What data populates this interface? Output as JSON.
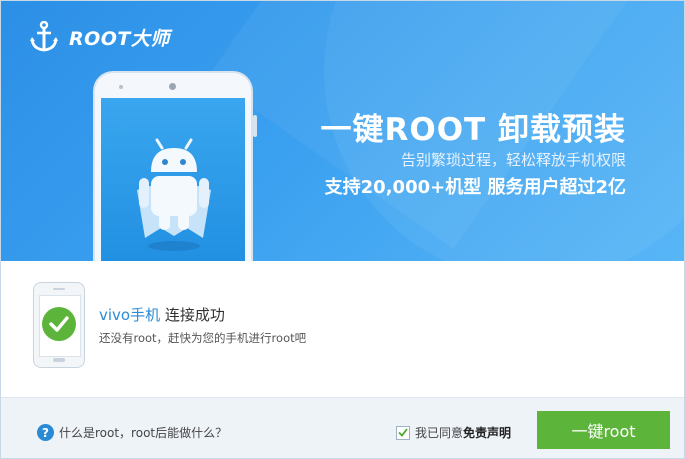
{
  "app": {
    "logo_text": "ROOT大师",
    "logo_icon": "anchor-icon"
  },
  "banner": {
    "headline": "一键ROOT 卸载预装",
    "subline": "告别繁琐过程，轻松释放手机权限",
    "stats": "支持20,000+机型 服务用户超过2亿",
    "illustration": "android-robot-icon"
  },
  "device": {
    "brand": "vivo手机",
    "status": "连接成功",
    "message": "还没有root，赶快为您的手机进行root吧",
    "icon": "phone-check-icon"
  },
  "footer": {
    "help_icon_glyph": "?",
    "help_text": "什么是root，root后能做什么？",
    "agree_checked": true,
    "agree_text": "我已同意",
    "disclaimer_link": "免责声明",
    "root_button_label": "一键root"
  },
  "colors": {
    "banner_blue": "#3aa0f0",
    "accent_green": "#5cb53a",
    "link_blue": "#2a8ad4",
    "footer_bg": "#eef3f8"
  }
}
